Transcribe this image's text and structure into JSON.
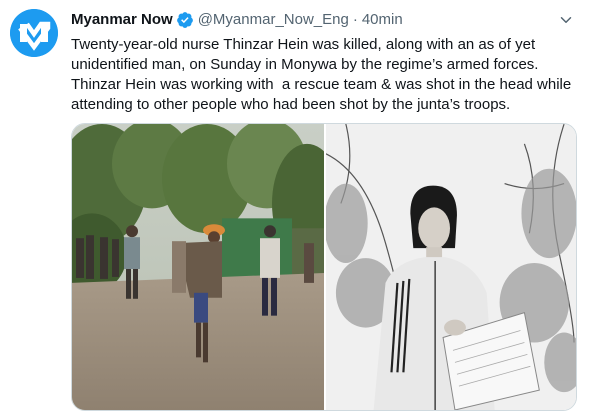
{
  "author": {
    "display_name": "Myanmar Now",
    "handle": "@Myanmar_Now_Eng",
    "separator": "·",
    "time": "40min",
    "avatar_icon": "myanmar-now-logo",
    "verified_icon": "verified-badge-icon"
  },
  "tweet": {
    "lines": [
      "Twenty-year-old nurse Thinzar Hein was killed, along with an as of yet",
      "unidentified man, on Sunday in Monywa by the regime’s armed forces.",
      "Thinzar Hein was working with  a rescue team & was shot in the head while",
      "attending to other people who had been shot by the junta’s troops."
    ]
  },
  "media": {
    "count": 2
  },
  "colors": {
    "accent": "#1d9bf0",
    "text": "#0f1419",
    "secondary": "#536471",
    "border": "#cfd9de"
  }
}
